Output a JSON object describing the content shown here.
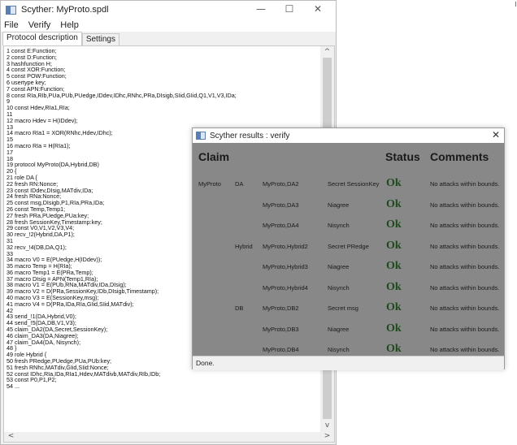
{
  "main_window": {
    "title": "Scyther: MyProto.spdl",
    "controls": {
      "minimize": "—",
      "maximize": "☐",
      "close": "✕"
    },
    "menu": [
      "File",
      "Verify",
      "Help"
    ],
    "tabs": [
      {
        "label": "Protocol description",
        "active": true
      },
      {
        "label": "Settings",
        "active": false
      }
    ],
    "code_lines": [
      "1 const E:Function;",
      "2 const D:Function;",
      "3 hashfunction H;",
      "4 const XOR:Function;",
      "5 const POW:Function;",
      "6 usertype key;",
      "7 const APN:Function;",
      "8 const RIa,RIb,PUa,PUb,PUedge,IDdev,IDhc,RNhc,PRa,DIsigb,SIid,GIid,Q1,V1,V3,IDa;",
      "9",
      "10 const Hdev,RIa1,RIa;",
      "11",
      "12 macro Hdev = H(IDdev);",
      "13",
      "14 macro RIa1 = XOR(RNhc,Hdev,IDhc);",
      "15",
      "16 macro RIa = H(RIa1);",
      "17",
      "18",
      "19 protocol MyProto(DA,Hybrid,DB)",
      "20 {",
      "21 role DA {",
      "22 fresh RN:Nonce;",
      "23 const IDdev,DIsig,MATdiv,IDa;",
      "24 fresh RNa:Nonce;",
      "25 const msg,DIsigb,P1,RIa,PRa,IDa;",
      "26 const Temp,Temp1;",
      "27 fresh PRa,PUedge,PUa:key;",
      "28 fresh SessionKey,Timestamp:key;",
      "29 const V0,V1,V2,V3,V4;",
      "30 recv_!2(Hybrid,DA,P1);",
      "31",
      "32 recv_!4(DB,DA,Q1);",
      "33",
      "34 macro V0 = E(PUedge,H(IDdev));",
      "35 macro Temp = H(RIa);",
      "36 macro Temp1 = E(PRa,Temp);",
      "37 macro DIsig = APN(Temp1,RIa);",
      "38 macro V1 = E(PUb,RNa,MATdiv,IDa,DIsig);",
      "39 macro V2 = D(PRa,SessionKey,IDb,DIsigb,Timestamp);",
      "40 macro V3 = E(SessionKey,msg);",
      "41 macro V4 = D(PRa,IDa,RIa,GIid,SIid,MATdiv);",
      "42",
      "43 send_!1(DA,Hybrid,V0);",
      "44 send_!5(DA,DB,V1,V3);",
      "45 claim_DA2(DA,Secret,SessionKey);",
      "46 claim_DA3(DA,Niagree);",
      "47 claim_DA4(DA, Nisynch);",
      "48 }",
      "49 role Hybrid {",
      "50 fresh PRedge,PUedge,PUa,PUb:key;",
      "51 fresh RNhc,MATdiv,GIid,SIid:Nonce;",
      "52 const IDhc,RIa,IDa,RIa1,Hdev,MATdivb,MATdiv,RIb,IDb;",
      "53 const P0,P1,P2;",
      "54 ..."
    ]
  },
  "results_window": {
    "title": "Scyther results : verify",
    "close": "✕",
    "headers": {
      "claim": "Claim",
      "status": "Status",
      "comments": "Comments"
    },
    "rows": [
      {
        "protocol": "MyProto",
        "role": "DA",
        "claim_id": "MyProto,DA2",
        "claim": "Secret SessionKey",
        "status": "Ok",
        "comment": "No attacks within bounds."
      },
      {
        "protocol": "",
        "role": "",
        "claim_id": "MyProto,DA3",
        "claim": "Niagree",
        "status": "Ok",
        "comment": "No attacks within bounds."
      },
      {
        "protocol": "",
        "role": "",
        "claim_id": "MyProto,DA4",
        "claim": "Nisynch",
        "status": "Ok",
        "comment": "No attacks within bounds."
      },
      {
        "protocol": "",
        "role": "Hybrid",
        "claim_id": "MyProto,Hybrid2",
        "claim": "Secret PRedge",
        "status": "Ok",
        "comment": "No attacks within bounds."
      },
      {
        "protocol": "",
        "role": "",
        "claim_id": "MyProto,Hybrid3",
        "claim": "Niagree",
        "status": "Ok",
        "comment": "No attacks within bounds."
      },
      {
        "protocol": "",
        "role": "",
        "claim_id": "MyProto,Hybrid4",
        "claim": "Nisynch",
        "status": "Ok",
        "comment": "No attacks within bounds."
      },
      {
        "protocol": "",
        "role": "DB",
        "claim_id": "MyProto,DB2",
        "claim": "Secret msg",
        "status": "Ok",
        "comment": "No attacks within bounds."
      },
      {
        "protocol": "",
        "role": "",
        "claim_id": "MyProto,DB3",
        "claim": "Niagree",
        "status": "Ok",
        "comment": "No attacks within bounds."
      },
      {
        "protocol": "",
        "role": "",
        "claim_id": "MyProto,DB4",
        "claim": "Nisynch",
        "status": "Ok",
        "comment": "No attacks within bounds."
      }
    ],
    "status_bar": "Done."
  },
  "colors": {
    "results_bg": "#888888",
    "ok_color": "#1e4a1e",
    "window_bg": "#f0f0f0"
  }
}
